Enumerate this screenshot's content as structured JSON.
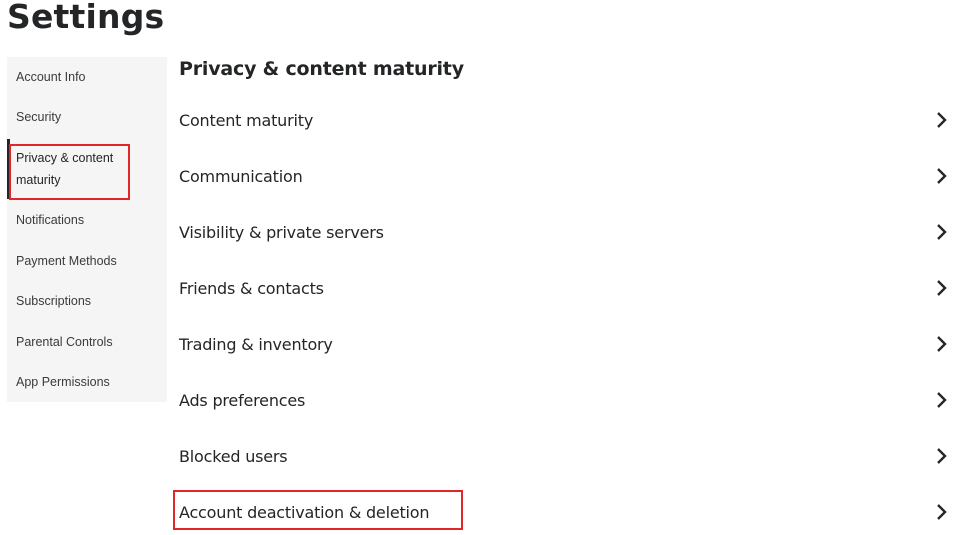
{
  "page": {
    "title": "Settings"
  },
  "sidebar": {
    "items": [
      {
        "label": "Account Info"
      },
      {
        "label": "Security"
      },
      {
        "label": "Privacy & content maturity",
        "label_line1": "Privacy & content",
        "label_line2": "maturity",
        "active": true
      },
      {
        "label": "Notifications"
      },
      {
        "label": "Payment Methods"
      },
      {
        "label": "Subscriptions"
      },
      {
        "label": "Parental Controls"
      },
      {
        "label": "App Permissions"
      }
    ]
  },
  "main": {
    "section_title": "Privacy & content maturity",
    "rows": [
      {
        "label": "Content maturity",
        "icon": "chevron-right-icon"
      },
      {
        "label": "Communication",
        "icon": "chevron-right-icon"
      },
      {
        "label": "Visibility & private servers",
        "icon": "chevron-right-icon"
      },
      {
        "label": "Friends & contacts",
        "icon": "chevron-right-icon"
      },
      {
        "label": "Trading & inventory",
        "icon": "chevron-right-icon"
      },
      {
        "label": "Ads preferences",
        "icon": "chevron-right-icon"
      },
      {
        "label": "Blocked users",
        "icon": "chevron-right-icon"
      },
      {
        "label": "Account deactivation & deletion",
        "icon": "chevron-right-icon",
        "highlighted": true
      }
    ]
  },
  "colors": {
    "highlight": "#e0262b",
    "sidebar_bg": "#f5f5f5",
    "text": "#232527"
  }
}
